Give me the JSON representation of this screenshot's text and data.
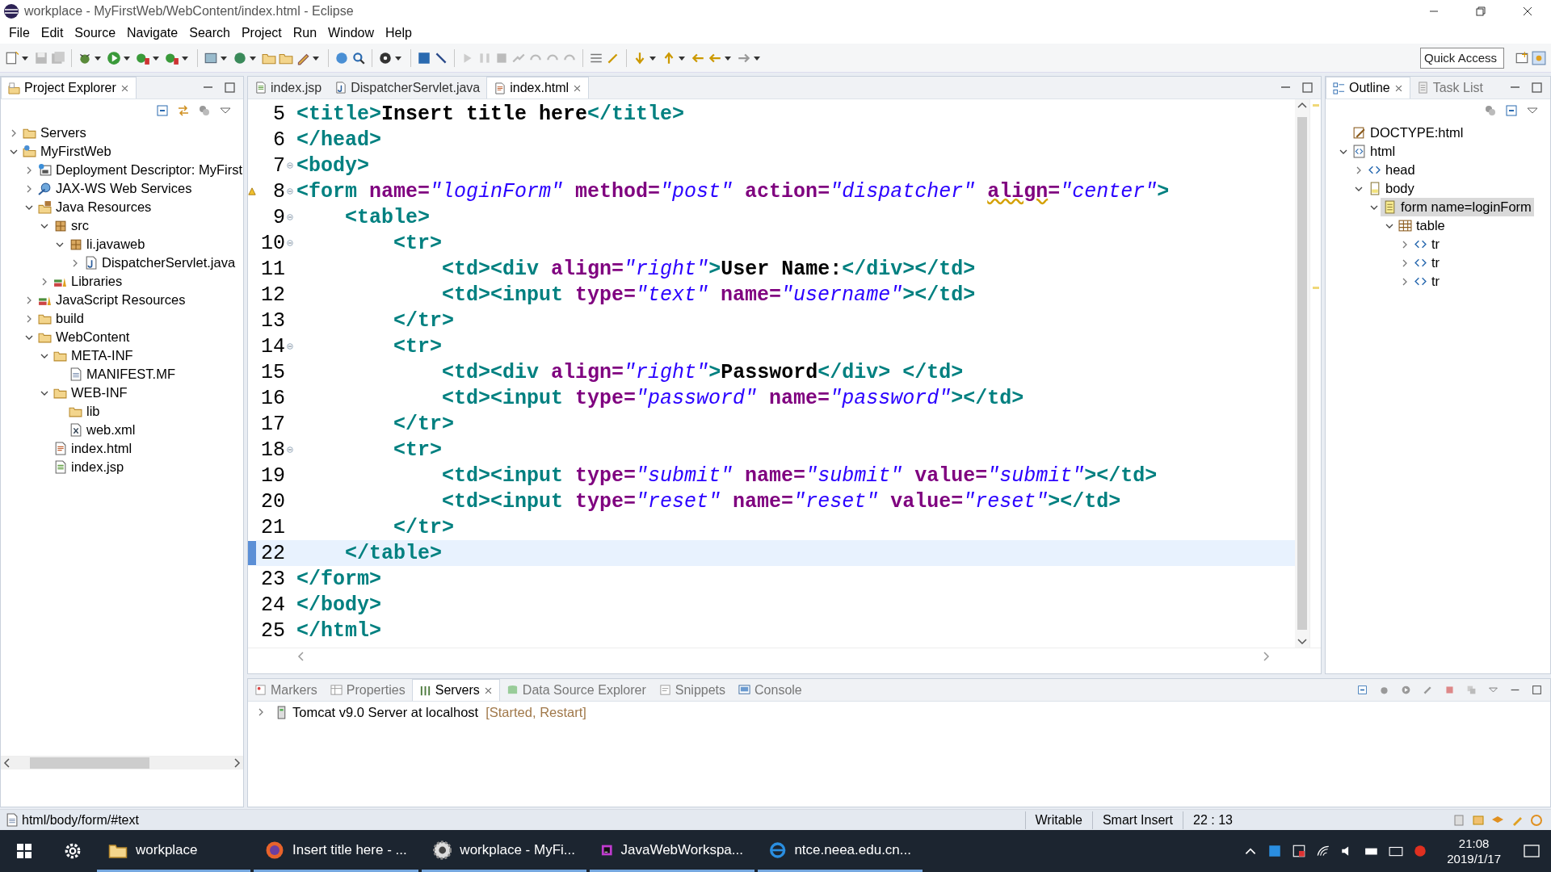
{
  "window": {
    "title": "workplace - MyFirstWeb/WebContent/index.html - Eclipse"
  },
  "menu": [
    "File",
    "Edit",
    "Source",
    "Navigate",
    "Search",
    "Project",
    "Run",
    "Window",
    "Help"
  ],
  "quick_access": {
    "placeholder": "Quick Access"
  },
  "project_explorer": {
    "tab": "Project Explorer",
    "items": [
      {
        "label": "Servers",
        "kind": "folder",
        "expanded": false
      },
      {
        "label": "MyFirstWeb",
        "kind": "project",
        "expanded": true,
        "children": [
          {
            "label": "Deployment Descriptor: MyFirst",
            "kind": "descriptor",
            "expanded": false
          },
          {
            "label": "JAX-WS Web Services",
            "kind": "webservice",
            "expanded": false
          },
          {
            "label": "Java Resources",
            "kind": "javares",
            "expanded": true,
            "children": [
              {
                "label": "src",
                "kind": "package",
                "expanded": true,
                "children": [
                  {
                    "label": "li.javaweb",
                    "kind": "package",
                    "expanded": true,
                    "children": [
                      {
                        "label": "DispatcherServlet.java",
                        "kind": "java",
                        "expanded": false
                      }
                    ]
                  }
                ]
              },
              {
                "label": "Libraries",
                "kind": "library",
                "expanded": false
              }
            ]
          },
          {
            "label": "JavaScript Resources",
            "kind": "library",
            "expanded": false
          },
          {
            "label": "build",
            "kind": "folder",
            "expanded": false
          },
          {
            "label": "WebContent",
            "kind": "folder",
            "expanded": true,
            "children": [
              {
                "label": "META-INF",
                "kind": "folder",
                "expanded": true,
                "children": [
                  {
                    "label": "MANIFEST.MF",
                    "kind": "file"
                  }
                ]
              },
              {
                "label": "WEB-INF",
                "kind": "folder",
                "expanded": true,
                "children": [
                  {
                    "label": "lib",
                    "kind": "folder"
                  },
                  {
                    "label": "web.xml",
                    "kind": "xml"
                  }
                ]
              },
              {
                "label": "index.html",
                "kind": "html"
              },
              {
                "label": "index.jsp",
                "kind": "jsp"
              }
            ]
          }
        ]
      }
    ]
  },
  "editor": {
    "tabs": [
      {
        "label": "index.jsp",
        "kind": "jsp",
        "selected": false
      },
      {
        "label": "DispatcherServlet.java",
        "kind": "java",
        "selected": false
      },
      {
        "label": "index.html",
        "kind": "html",
        "selected": true
      }
    ],
    "lines": [
      {
        "number": "5",
        "tokens": [
          {
            "kind": "tag",
            "text": "<title>"
          },
          {
            "kind": "text",
            "text": "Insert title here"
          },
          {
            "kind": "tag",
            "text": "</title>"
          }
        ]
      },
      {
        "number": "6",
        "tokens": [
          {
            "kind": "tag",
            "text": "</head>"
          }
        ]
      },
      {
        "number": "7",
        "fold": true,
        "tokens": [
          {
            "kind": "tag",
            "text": "<body>"
          }
        ]
      },
      {
        "number": "8",
        "fold": true,
        "warning": true,
        "tokens": [
          {
            "kind": "tag",
            "text": "<form"
          },
          {
            "kind": "attr",
            "text": " name="
          },
          {
            "kind": "value",
            "text": "\"loginForm\""
          },
          {
            "kind": "attr",
            "text": " method="
          },
          {
            "kind": "value",
            "text": "\"post\""
          },
          {
            "kind": "attr",
            "text": " action="
          },
          {
            "kind": "value",
            "text": "\"dispatcher\" "
          },
          {
            "kind": "attr",
            "text": "align",
            "warning": true
          },
          {
            "kind": "attr",
            "text": "="
          },
          {
            "kind": "value",
            "text": "\"center\""
          },
          {
            "kind": "tag",
            "text": ">"
          }
        ]
      },
      {
        "number": "9",
        "fold": true,
        "tokens": [
          {
            "kind": "tag",
            "text": "    <table>"
          }
        ]
      },
      {
        "number": "10",
        "fold": true,
        "tokens": [
          {
            "kind": "tag",
            "text": "        <tr>"
          }
        ]
      },
      {
        "number": "11",
        "tokens": [
          {
            "kind": "tag",
            "text": "            <td><div"
          },
          {
            "kind": "attr",
            "text": " align="
          },
          {
            "kind": "value",
            "text": "\"right\""
          },
          {
            "kind": "tag",
            "text": ">"
          },
          {
            "kind": "text",
            "text": "User Name:"
          },
          {
            "kind": "tag",
            "text": "</div></td>"
          }
        ]
      },
      {
        "number": "12",
        "tokens": [
          {
            "kind": "tag",
            "text": "            <td><input"
          },
          {
            "kind": "attr",
            "text": " type="
          },
          {
            "kind": "value",
            "text": "\"text\""
          },
          {
            "kind": "attr",
            "text": " name="
          },
          {
            "kind": "value",
            "text": "\"username\""
          },
          {
            "kind": "tag",
            "text": "></td>"
          }
        ]
      },
      {
        "number": "13",
        "tokens": [
          {
            "kind": "tag",
            "text": "        </tr>"
          }
        ]
      },
      {
        "number": "14",
        "fold": true,
        "tokens": [
          {
            "kind": "tag",
            "text": "        <tr>"
          }
        ]
      },
      {
        "number": "15",
        "tokens": [
          {
            "kind": "tag",
            "text": "            <td><div"
          },
          {
            "kind": "attr",
            "text": " align="
          },
          {
            "kind": "value",
            "text": "\"right\""
          },
          {
            "kind": "tag",
            "text": ">"
          },
          {
            "kind": "text",
            "text": "Password"
          },
          {
            "kind": "tag",
            "text": "</div> </td>"
          }
        ]
      },
      {
        "number": "16",
        "tokens": [
          {
            "kind": "tag",
            "text": "            <td><input"
          },
          {
            "kind": "attr",
            "text": " type="
          },
          {
            "kind": "value",
            "text": "\"password\""
          },
          {
            "kind": "attr",
            "text": " name="
          },
          {
            "kind": "value",
            "text": "\"password\""
          },
          {
            "kind": "tag",
            "text": "></td>"
          }
        ]
      },
      {
        "number": "17",
        "tokens": [
          {
            "kind": "tag",
            "text": "        </tr>"
          }
        ]
      },
      {
        "number": "18",
        "fold": true,
        "tokens": [
          {
            "kind": "tag",
            "text": "        <tr>"
          }
        ]
      },
      {
        "number": "19",
        "tokens": [
          {
            "kind": "tag",
            "text": "            <td><input"
          },
          {
            "kind": "attr",
            "text": " type="
          },
          {
            "kind": "value",
            "text": "\"submit\""
          },
          {
            "kind": "attr",
            "text": " name="
          },
          {
            "kind": "value",
            "text": "\"submit\""
          },
          {
            "kind": "attr",
            "text": " value="
          },
          {
            "kind": "value",
            "text": "\"submit\""
          },
          {
            "kind": "tag",
            "text": "></td>"
          }
        ]
      },
      {
        "number": "20",
        "tokens": [
          {
            "kind": "tag",
            "text": "            <td><input"
          },
          {
            "kind": "attr",
            "text": " type="
          },
          {
            "kind": "value",
            "text": "\"reset\""
          },
          {
            "kind": "attr",
            "text": " name="
          },
          {
            "kind": "value",
            "text": "\"reset\""
          },
          {
            "kind": "attr",
            "text": " value="
          },
          {
            "kind": "value",
            "text": "\"reset\""
          },
          {
            "kind": "tag",
            "text": "></td>"
          }
        ]
      },
      {
        "number": "21",
        "tokens": [
          {
            "kind": "tag",
            "text": "        </tr>"
          }
        ]
      },
      {
        "number": "22",
        "current": true,
        "tokens": [
          {
            "kind": "tag",
            "text": "    </table>"
          }
        ]
      },
      {
        "number": "23",
        "tokens": [
          {
            "kind": "tag",
            "text": "</form>"
          }
        ]
      },
      {
        "number": "24",
        "tokens": [
          {
            "kind": "tag",
            "text": "</body>"
          }
        ]
      },
      {
        "number": "25",
        "tokens": [
          {
            "kind": "tag",
            "text": "</html>"
          }
        ]
      }
    ]
  },
  "outline": {
    "tabs": [
      {
        "label": "Outline",
        "kind": "outline",
        "selected": true
      },
      {
        "label": "Task List",
        "kind": "tasks",
        "selected": false
      }
    ],
    "items": [
      {
        "label": "DOCTYPE:html",
        "kind": "doctype",
        "selected": false
      },
      {
        "label": "html",
        "kind": "element",
        "expanded": true,
        "selected": false,
        "children": [
          {
            "label": "head",
            "kind": "tag",
            "expanded": false,
            "selected": false
          },
          {
            "label": "body",
            "kind": "body",
            "expanded": true,
            "selected": false,
            "children": [
              {
                "label": "form name=loginForm",
                "kind": "form",
                "expanded": true,
                "selected": true,
                "children": [
                  {
                    "label": "table",
                    "kind": "table",
                    "expanded": true,
                    "selected": false,
                    "children": [
                      {
                        "label": "tr",
                        "kind": "tag",
                        "expanded": false,
                        "selected": false
                      },
                      {
                        "label": "tr",
                        "kind": "tag",
                        "expanded": false,
                        "selected": false
                      },
                      {
                        "label": "tr",
                        "kind": "tag",
                        "expanded": false,
                        "selected": false
                      }
                    ]
                  }
                ]
              }
            ]
          }
        ]
      }
    ]
  },
  "bottom_panel": {
    "tabs": [
      {
        "label": "Markers",
        "kind": "markers",
        "selected": false
      },
      {
        "label": "Properties",
        "kind": "properties",
        "selected": false
      },
      {
        "label": "Servers",
        "kind": "servers",
        "selected": true
      },
      {
        "label": "Data Source Explorer",
        "kind": "datasource",
        "selected": false
      },
      {
        "label": "Snippets",
        "kind": "snippets",
        "selected": false
      },
      {
        "label": "Console",
        "kind": "console",
        "selected": false
      }
    ],
    "servers": [
      {
        "name": "Tomcat v9.0 Server at localhost",
        "state": "[Started, Restart]",
        "expanded": false
      }
    ]
  },
  "status_bar": {
    "path": "html/body/form/#text",
    "mode": "Writable",
    "insert": "Smart Insert",
    "position": "22 : 13"
  },
  "taskbar": {
    "items": [
      {
        "label": "workplace",
        "kind": "folder"
      },
      {
        "label": "Insert title here - ...",
        "kind": "firefox"
      },
      {
        "label": "workplace - MyFi...",
        "kind": "eclipse"
      },
      {
        "label": "JavaWebWorkspa...",
        "kind": "intellij"
      },
      {
        "label": "ntce.neea.edu.cn...",
        "kind": "ie"
      }
    ],
    "time": "21:08",
    "date": "2019/1/17"
  }
}
